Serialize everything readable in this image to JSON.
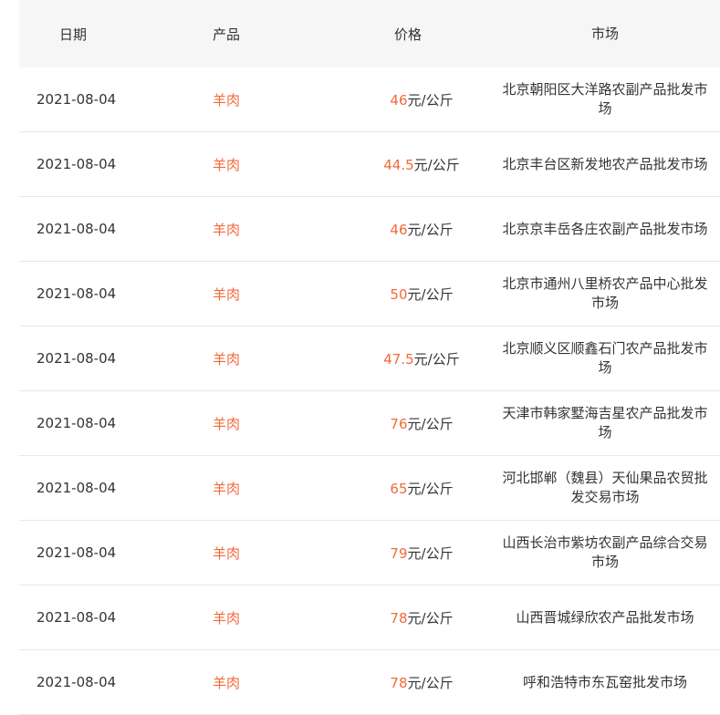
{
  "table": {
    "headers": {
      "date": "日期",
      "product": "产品",
      "price": "价格",
      "market": "市场"
    },
    "rows": [
      {
        "date": "2021-08-04",
        "product": "羊肉",
        "price": "46",
        "unit": "元/公斤",
        "market": "北京朝阳区大洋路农副产品批发市场"
      },
      {
        "date": "2021-08-04",
        "product": "羊肉",
        "price": "44.5",
        "unit": "元/公斤",
        "market": "北京丰台区新发地农产品批发市场"
      },
      {
        "date": "2021-08-04",
        "product": "羊肉",
        "price": "46",
        "unit": "元/公斤",
        "market": "北京京丰岳各庄农副产品批发市场"
      },
      {
        "date": "2021-08-04",
        "product": "羊肉",
        "price": "50",
        "unit": "元/公斤",
        "market": "北京市通州八里桥农产品中心批发市场"
      },
      {
        "date": "2021-08-04",
        "product": "羊肉",
        "price": "47.5",
        "unit": "元/公斤",
        "market": "北京顺义区顺鑫石门农产品批发市场"
      },
      {
        "date": "2021-08-04",
        "product": "羊肉",
        "price": "76",
        "unit": "元/公斤",
        "market": "天津市韩家墅海吉星农产品批发市场"
      },
      {
        "date": "2021-08-04",
        "product": "羊肉",
        "price": "65",
        "unit": "元/公斤",
        "market": "河北邯郸（魏县）天仙果品农贸批发交易市场"
      },
      {
        "date": "2021-08-04",
        "product": "羊肉",
        "price": "79",
        "unit": "元/公斤",
        "market": "山西长治市紫坊农副产品综合交易市场"
      },
      {
        "date": "2021-08-04",
        "product": "羊肉",
        "price": "78",
        "unit": "元/公斤",
        "market": "山西晋城绿欣农产品批发市场"
      },
      {
        "date": "2021-08-04",
        "product": "羊肉",
        "price": "78",
        "unit": "元/公斤",
        "market": "呼和浩特市东瓦窑批发市场"
      }
    ]
  },
  "colors": {
    "accent": "#f26a3b",
    "header_bg": "#f6f6f6",
    "divider": "#e8e8e8"
  }
}
